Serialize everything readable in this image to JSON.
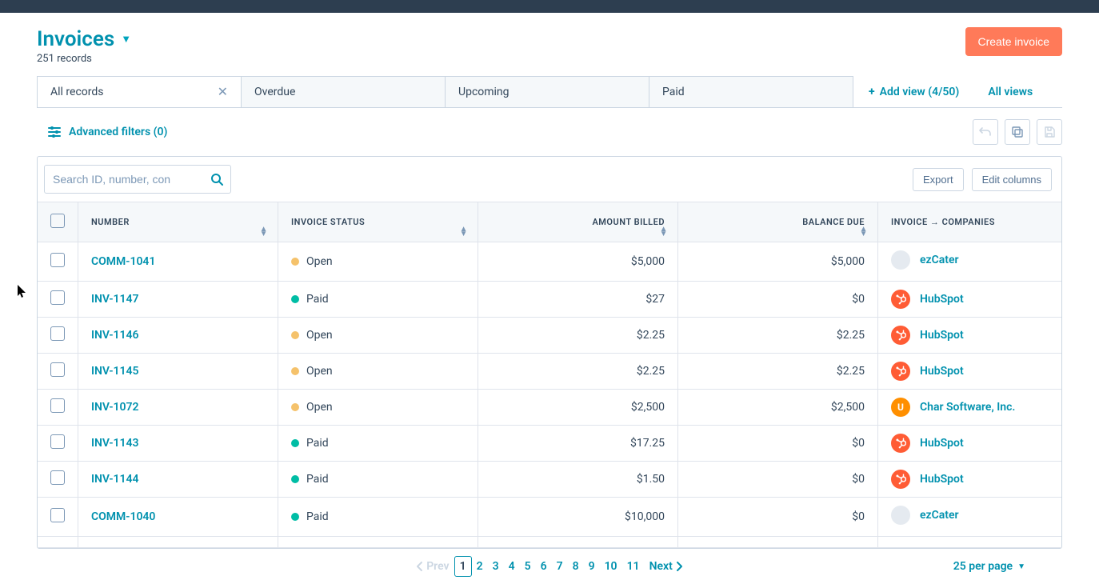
{
  "header": {
    "title": "Invoices",
    "record_count": "251 records",
    "create_button": "Create invoice"
  },
  "tabs": {
    "items": [
      {
        "label": "All records",
        "closable": true,
        "active": true
      },
      {
        "label": "Overdue",
        "closable": false,
        "active": false
      },
      {
        "label": "Upcoming",
        "closable": false,
        "active": false
      },
      {
        "label": "Paid",
        "closable": false,
        "active": false
      }
    ],
    "add_view": "Add view (4/50)",
    "all_views": "All views"
  },
  "filters": {
    "advanced": "Advanced filters (0)"
  },
  "search": {
    "placeholder": "Search ID, number, con"
  },
  "actions": {
    "export": "Export",
    "edit_columns": "Edit columns"
  },
  "columns": {
    "number": "NUMBER",
    "status": "INVOICE STATUS",
    "billed": "AMOUNT BILLED",
    "balance": "BALANCE DUE",
    "companies": "INVOICE → COMPANIES"
  },
  "rows": [
    {
      "number": "COMM-1041",
      "status": "Open",
      "status_kind": "open",
      "billed": "$5,000",
      "balance": "$5,000",
      "company": "ezCater",
      "company_kind": "ezcater",
      "company_initial": ""
    },
    {
      "number": "INV-1147",
      "status": "Paid",
      "status_kind": "paid",
      "billed": "$27",
      "balance": "$0",
      "company": "HubSpot",
      "company_kind": "hubspot",
      "company_initial": ""
    },
    {
      "number": "INV-1146",
      "status": "Open",
      "status_kind": "open",
      "billed": "$2.25",
      "balance": "$2.25",
      "company": "HubSpot",
      "company_kind": "hubspot",
      "company_initial": ""
    },
    {
      "number": "INV-1145",
      "status": "Open",
      "status_kind": "open",
      "billed": "$2.25",
      "balance": "$2.25",
      "company": "HubSpot",
      "company_kind": "hubspot",
      "company_initial": ""
    },
    {
      "number": "INV-1072",
      "status": "Open",
      "status_kind": "open",
      "billed": "$2,500",
      "balance": "$2,500",
      "company": "Char Software, Inc.",
      "company_kind": "char",
      "company_initial": "U"
    },
    {
      "number": "INV-1143",
      "status": "Paid",
      "status_kind": "paid",
      "billed": "$17.25",
      "balance": "$0",
      "company": "HubSpot",
      "company_kind": "hubspot",
      "company_initial": ""
    },
    {
      "number": "INV-1144",
      "status": "Paid",
      "status_kind": "paid",
      "billed": "$1.50",
      "balance": "$0",
      "company": "HubSpot",
      "company_kind": "hubspot",
      "company_initial": ""
    },
    {
      "number": "COMM-1040",
      "status": "Paid",
      "status_kind": "paid",
      "billed": "$10,000",
      "balance": "$0",
      "company": "ezCater",
      "company_kind": "ezcater",
      "company_initial": ""
    }
  ],
  "pagination": {
    "prev": "Prev",
    "pages": [
      "1",
      "2",
      "3",
      "4",
      "5",
      "6",
      "7",
      "8",
      "9",
      "10",
      "11"
    ],
    "next": "Next",
    "per_page": "25 per page"
  }
}
